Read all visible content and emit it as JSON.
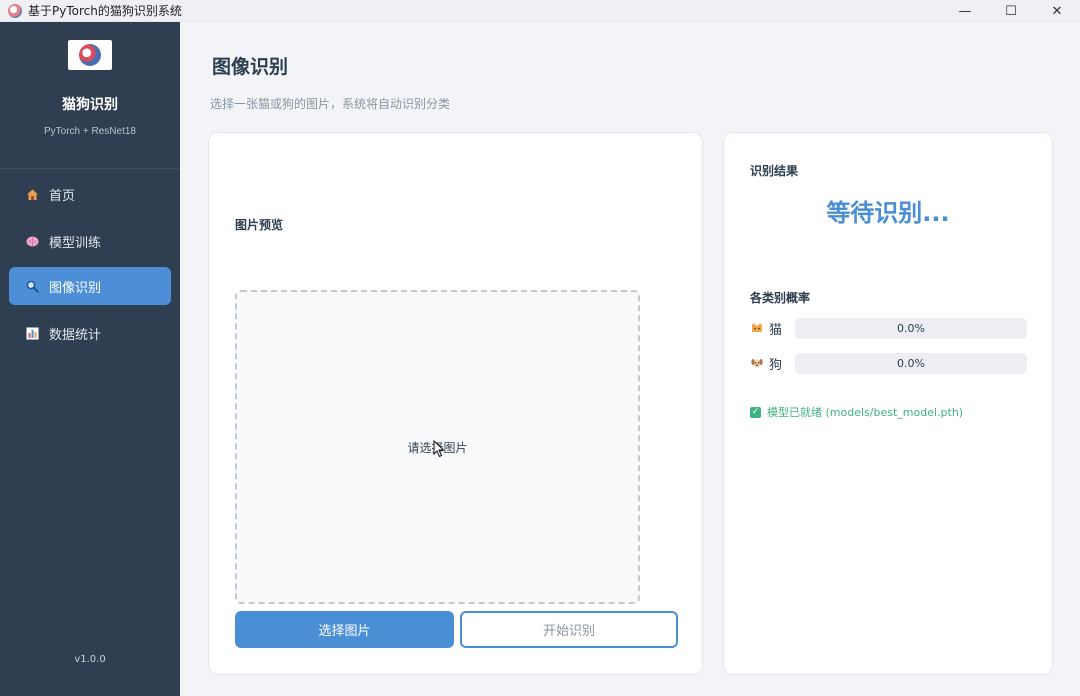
{
  "window": {
    "title": "基于PyTorch的猫狗识别系统",
    "controls": {
      "minimize": "—",
      "maximize": "☐",
      "close": "✕"
    }
  },
  "sidebar": {
    "brand_title": "猫狗识别",
    "brand_subtitle": "PyTorch + ResNet18",
    "items": [
      {
        "label": "首页",
        "icon": "home-icon",
        "active": false
      },
      {
        "label": "模型训练",
        "icon": "brain-icon",
        "active": false
      },
      {
        "label": "图像识别",
        "icon": "search-icon",
        "active": true
      },
      {
        "label": "数据统计",
        "icon": "bar-chart-icon",
        "active": false
      }
    ],
    "version": "v1.0.0"
  },
  "main": {
    "title": "图像识别",
    "subtitle": "选择一张猫或狗的图片，系统将自动识别分类",
    "preview": {
      "label": "图片预览",
      "placeholder": "请选择图片"
    },
    "buttons": {
      "select": "选择图片",
      "start": "开始识别"
    },
    "result": {
      "label": "识别结果",
      "value": "等待识别...",
      "prob_label": "各类别概率",
      "classes": [
        {
          "name": "猫",
          "icon": "cat-icon",
          "percent_text": "0.0%",
          "value": 0.0
        },
        {
          "name": "狗",
          "icon": "dog-icon",
          "percent_text": "0.0%",
          "value": 0.0
        }
      ],
      "status": "模型已就绪 (models/best_model.pth)"
    }
  },
  "colors": {
    "sidebar_bg": "#2f3e50",
    "accent": "#4a8fd6",
    "success": "#3fb37f"
  }
}
